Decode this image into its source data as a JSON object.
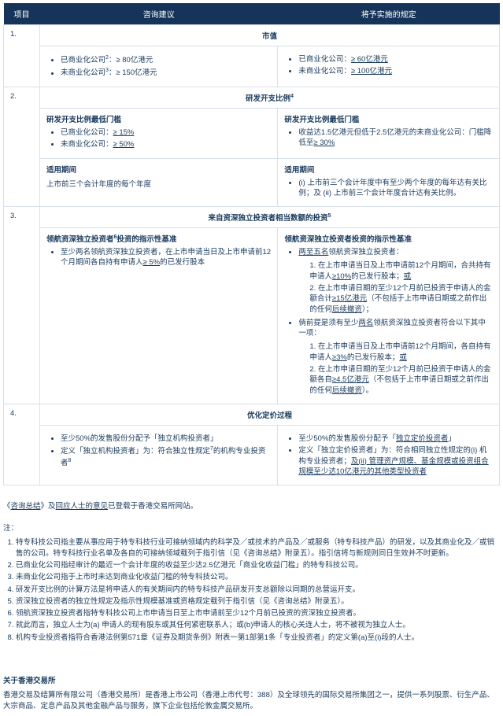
{
  "headers": {
    "item": "项目",
    "consult": "咨询建议",
    "final": "将予实施的规定"
  },
  "rows": {
    "r1": {
      "num": "1.",
      "title": "市值",
      "left": {
        "b1": "已商业化公司",
        "b1sup": "2",
        "b1rest": "：≥ 80亿港元",
        "b2": "未商业化公司",
        "b2sup": "3",
        "b2rest": "：≥ 150亿港元"
      },
      "right": {
        "b1a": "已商业化公司：",
        "b1u": "≥ 60亿港元",
        "b2a": "未商业化公司：",
        "b2u": "≥ 100亿港元"
      }
    },
    "r2": {
      "num": "2.",
      "title": "研发开支比例",
      "title_sup": "4",
      "left_head": "研发开支比例最低门槛",
      "left_b1a": "已商业化公司：",
      "left_b1u": "≥ 15%",
      "left_b2a": "未商业化公司：",
      "left_b2u": "≥ 50%",
      "right_head": "研发开支比例最低门槛",
      "right_b1a": "收益达1.5亿港元但低于2.5亿港元的未商业化公司：门槛降低至",
      "right_b1u": "≥ 30%",
      "leftp_head": "适用期间",
      "leftp_text": "上市前三个会计年度的每个年度",
      "rightp_head": "适用期间",
      "rightp_b1": "(i) 上市前三个会计年度中有至少两个年度的每年达有关比例；及 (ii) 上市前三个会计年度合计达有关比例。"
    },
    "r3": {
      "num": "3.",
      "title": "来自资深独立投资者相当数额的投资",
      "title_sup": "5",
      "left_head_a": "领航资深独立投资者",
      "left_head_sup": "6",
      "left_head_b": "投资的指示性基准",
      "left_b1a": "至少两名领航资深独立投资者，在上市申请当日及上市申请前12个月期间各自持有申请人",
      "left_b1u": "≥ 5%",
      "left_b1b": "的已发行股本",
      "right_head": "领航资深独立投资者投资的指示性基准",
      "right_intro": "两至五名",
      "right_intro2": "领航资深独立投资者：",
      "right_s1a": "1. 在上市申请当日及上市申请前12个月期间，合共持有申请人",
      "right_s1u": "≥10%",
      "right_s1b": "的已发行股本；",
      "right_or1": "或",
      "right_s2a": "2. 在上市申请日期的至少12个月前已投资于申请人的金额合计",
      "right_s2u": "≥15亿港元",
      "right_s2b": "（不包括于上市申请日期或之前作出的任何",
      "right_s2c": "后续撤资",
      "right_s2d": "）；",
      "right_proviso": "倘前提是须有至少",
      "right_proviso_u": "两名",
      "right_proviso2": "领航资深独立投资者符合以下其中一项：",
      "right_p1a": "1. 在上市申请当日及上市申请前12个月期间，各自持有申请人",
      "right_p1u": "≥3%",
      "right_p1b": "的已发行股本；",
      "right_or2": "或",
      "right_p2a": "2. 在上市申请日期的至少12个月前已投资于申请人的金额各自",
      "right_p2u": "≥4.5亿港元",
      "right_p2b": "（不包括于上市申请日期或之前作出的任何",
      "right_p2c": "后续撤资",
      "right_p2d": "）。"
    },
    "r4": {
      "num": "4.",
      "title": "优化定价过程",
      "left_b1a": "至少50%的发售股份分配予「独立机构投资者」",
      "left_b2a": "定义「独立机构投资者」为：符合独立性规定",
      "left_b2sup": "7",
      "left_b2b": "的机构专业投资者",
      "left_b2sup2": "8",
      "right_b1a": "至少50%的发售股份分配予「",
      "right_b1u": "独立定价投资者",
      "right_b1b": "」",
      "right_b2a": "定义「独立定价投资者」为：符合相同独立性规定的(i) 机构专业投资者；",
      "right_b2u": "及(ii) 管理资产规模、基金规模或投资组合规模至少达10亿港元的其他类型投资者"
    }
  },
  "footer_para_a": "《",
  "footer_link1": "咨询总结",
  "footer_para_b": "》及",
  "footer_link2": "回应人士的意见",
  "footer_para_c": "已登载于香港交易所网站。",
  "notes_label": "注：",
  "notes": {
    "n1": "特专科技公司指主要从事应用于特专科技行业可接纳领域内的科学及／或技术的产品及／或服务（特专科技产品）的研发，以及其商业化及／或销售的公司。特专科技行业名单及各自的可接纳领域载列于指引信（见《咨询总结》附录五）。指引信将与新规则同日生效并不时更新。",
    "n2": "已商业化公司指经审计的最近一个会计年度的收益至少达2.5亿港元「商业化收益门槛」的特专科技公司。",
    "n3": "未商业化公司指于上市时未达到商业化收益门槛的特专科技公司。",
    "n4": "研发开支比例的计算方法是将申请人的有关期间内的特专科技产品研发开支总额除以同期的总营运开支。",
    "n5": "资深独立投资者的独立性规定及指示性规模基准或资格规定载列于指引信（见《咨询总结》附录五）。",
    "n6": "领航资深独立投资者指特专科技公司上市申请当日至上市申请前至少12个月前已投资的资深独立投资者。",
    "n7": "就此而言，独立人士为(a) 申请人的现有股东或其任何紧密联系人；或(b)申请人的核心关连人士，将不被视为独立人士。",
    "n8": "机构专业投资者指符合香港法例第571章《证券及期货条例》附表一第1部第1条「专业投资者」的定义第(a)至(i)段的人士。"
  },
  "about_title": "关于香港交易所",
  "about_text": "香港交易及结算所有限公司（香港交易所）是香港上市公司（香港上市代号：388）及全球领先的国际交易所集团之一，提供一系列股票、衍生产品、大宗商品、定息产品及其他金融产品与服务，旗下企业包括伦敦金属交易所。"
}
